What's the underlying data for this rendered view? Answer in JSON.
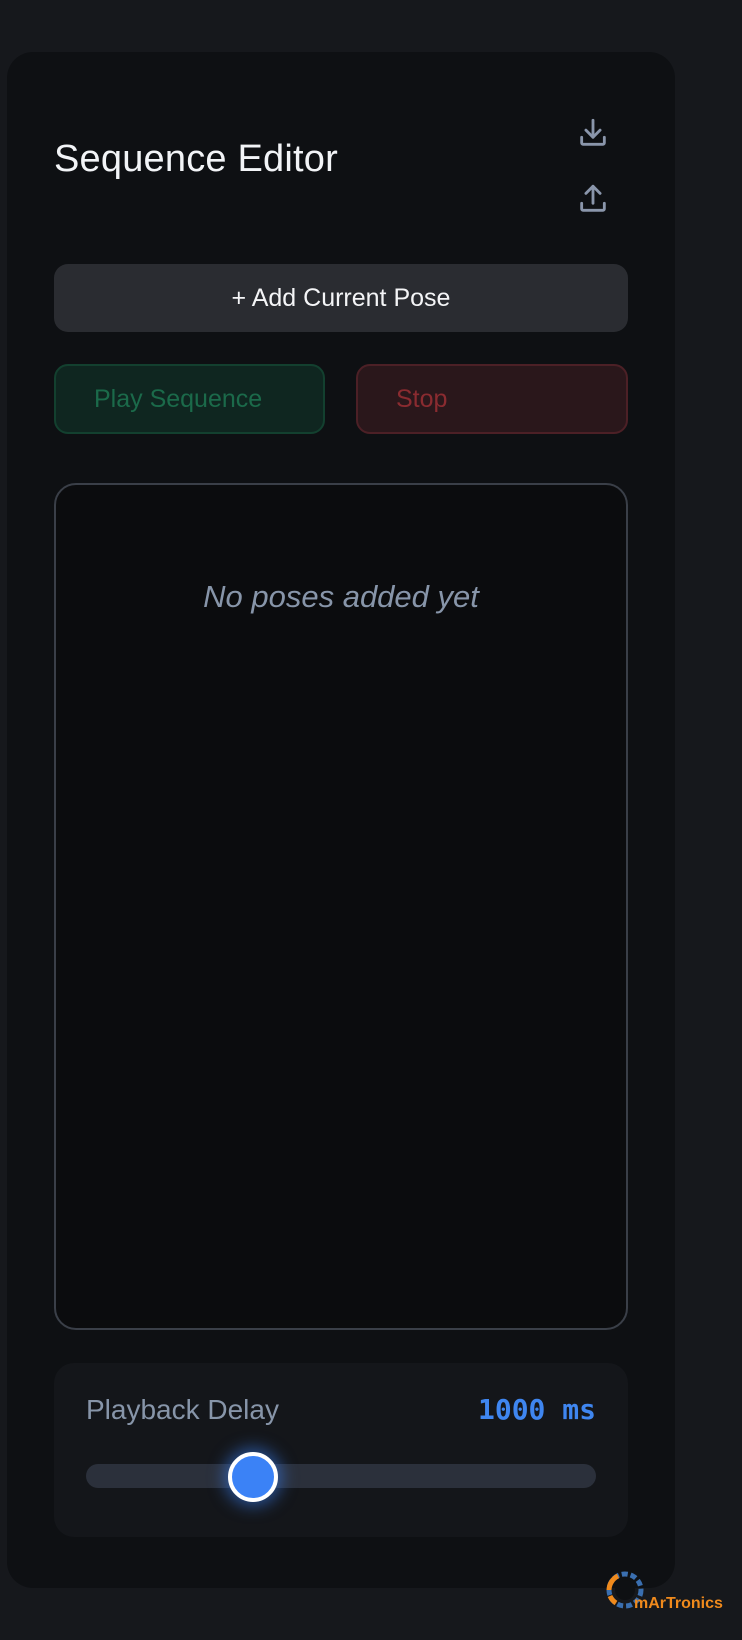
{
  "panel": {
    "title": "Sequence Editor",
    "download_icon": "download-icon",
    "upload_icon": "upload-icon"
  },
  "actions": {
    "add_label": "+ Add Current Pose",
    "play_label": "Play Sequence",
    "stop_label": "Stop"
  },
  "pose_list": {
    "empty_message": "No poses added yet"
  },
  "playback": {
    "label": "Playback Delay",
    "value_text": "1000 ms",
    "slider_fraction": 0.32
  },
  "brand": {
    "name": "mArTronics"
  },
  "colors": {
    "accent": "#3b82f6",
    "play": "#1b6a4a",
    "stop": "#8a2b30",
    "brand": "#f08a1c"
  }
}
